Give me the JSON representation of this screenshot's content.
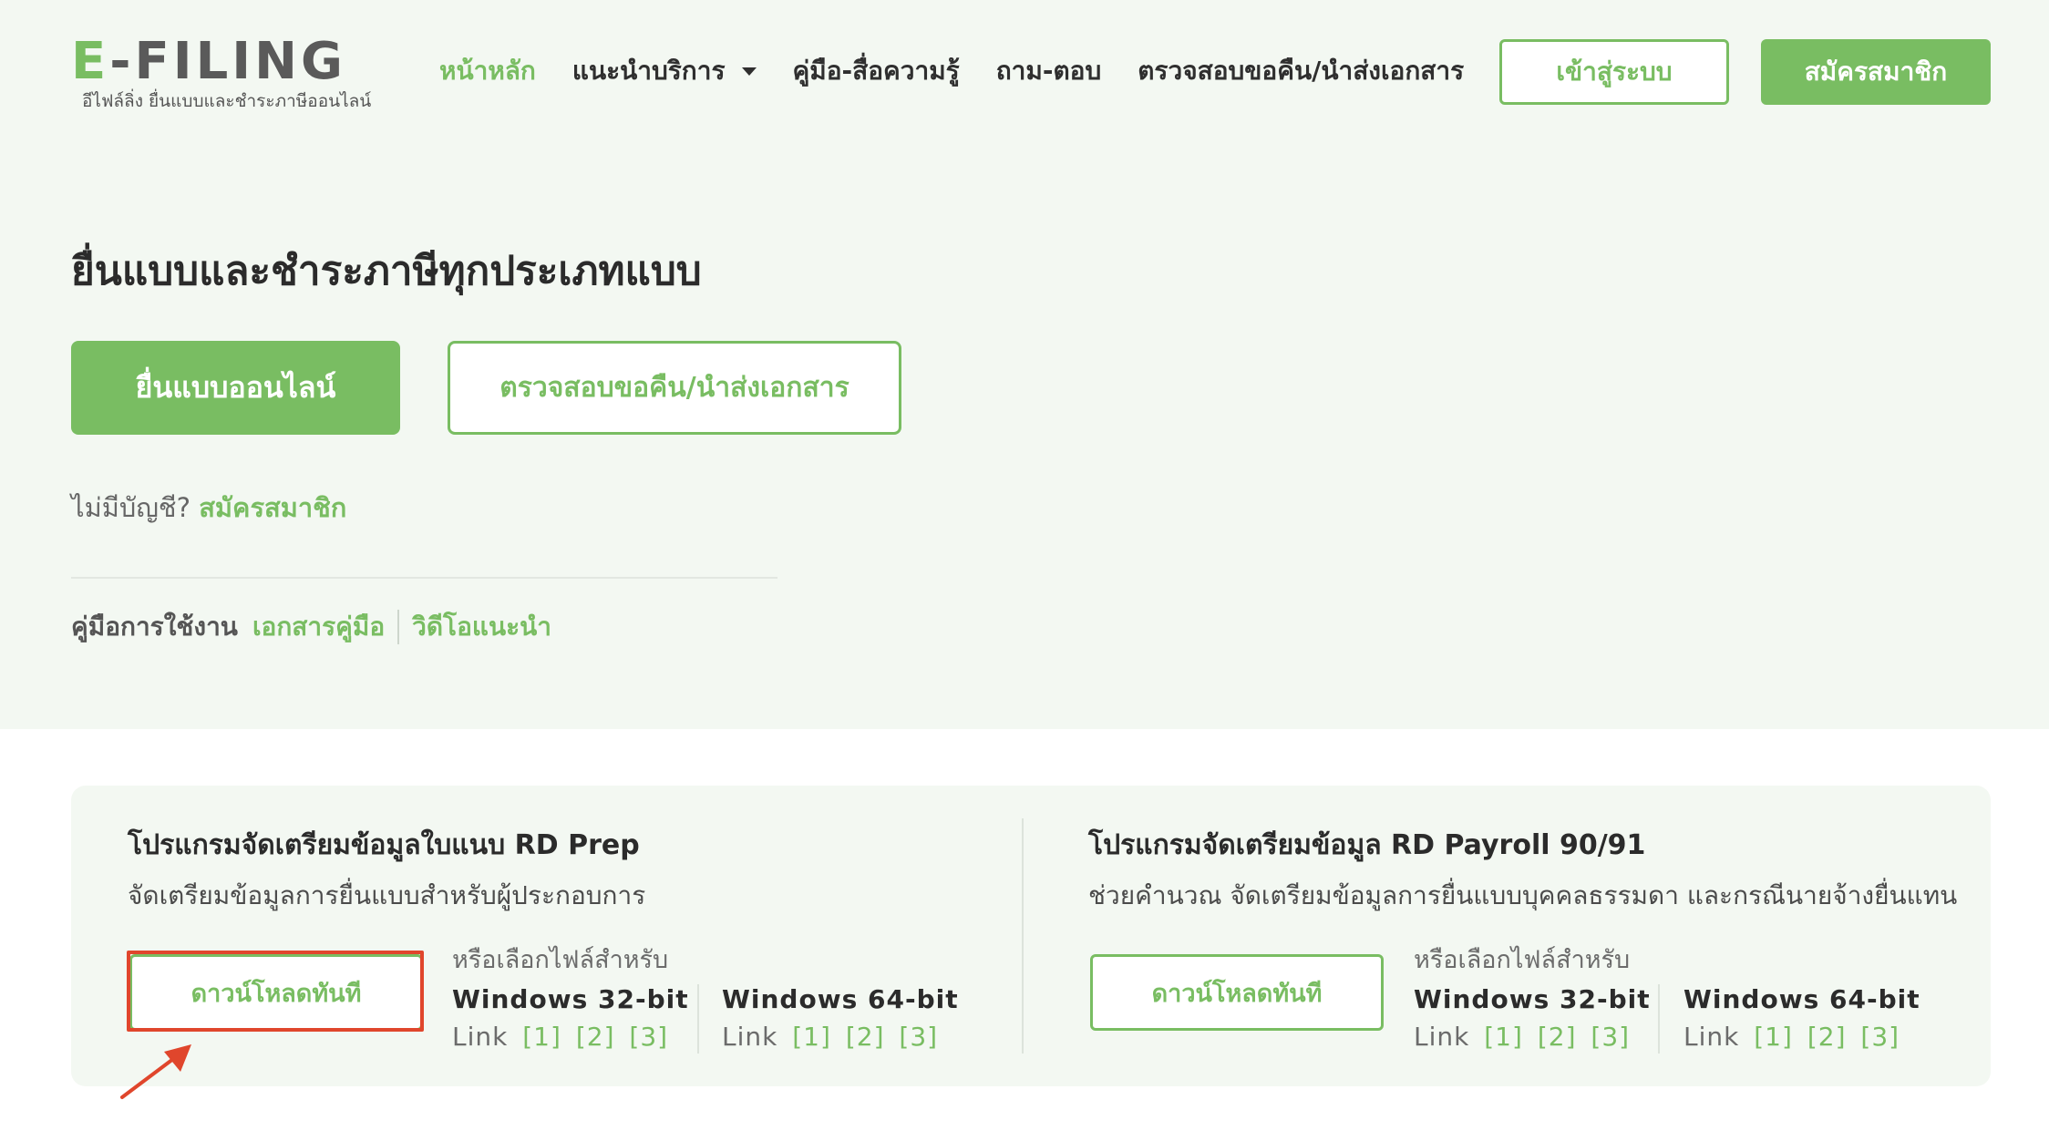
{
  "brand": {
    "logo_e": "E",
    "logo_rest": "-FILING",
    "tagline": "อีไฟล์ลิ่ง ยื่นแบบและชำระภาษีออนไลน์",
    "accent": "#79bd62",
    "highlight": "#e0462c"
  },
  "nav": {
    "home": "หน้าหลัก",
    "services": "แนะนำบริการ",
    "guide": "คู่มือ-สื่อความรู้",
    "faq": "ถาม-ตอบ",
    "refund": "ตรวจสอบขอคืน/นำส่งเอกสาร",
    "login": "เข้าสู่ระบบ",
    "register": "สมัครสมาชิก"
  },
  "hero": {
    "title": "ยื่นแบบและชำระภาษีทุกประเภทแบบ",
    "file_online": "ยื่นแบบออนไลน์",
    "check_refund": "ตรวจสอบขอคืน/นำส่งเอกสาร",
    "no_account": "ไม่มีบัญชี?",
    "register_link": "สมัครสมาชิก",
    "manual_label": "คู่มือการใช้งาน",
    "manual_docs": "เอกสารคู่มือ",
    "manual_video": "วิดีโอแนะนำ"
  },
  "downloads": [
    {
      "title": "โปรแกรมจัดเตรียมข้อมูลใบแนบ RD Prep",
      "subtitle": "จัดเตรียมข้อมูลการยื่นแบบสำหรับผู้ประกอบการ",
      "button": "ดาวน์โหลดทันที",
      "or_choose": "หรือเลือกไฟล์สำหรับ",
      "os": [
        {
          "name": "Windows 32-bit",
          "link_label": "Link",
          "links": [
            "[1]",
            "[2]",
            "[3]"
          ]
        },
        {
          "name": "Windows 64-bit",
          "link_label": "Link",
          "links": [
            "[1]",
            "[2]",
            "[3]"
          ]
        }
      ]
    },
    {
      "title": "โปรแกรมจัดเตรียมข้อมูล RD Payroll 90/91",
      "subtitle": "ช่วยคำนวณ จัดเตรียมข้อมูลการยื่นแบบบุคคลธรรมดา และกรณีนายจ้างยื่นแทน",
      "button": "ดาวน์โหลดทันที",
      "or_choose": "หรือเลือกไฟล์สำหรับ",
      "os": [
        {
          "name": "Windows 32-bit",
          "link_label": "Link",
          "links": [
            "[1]",
            "[2]",
            "[3]"
          ]
        },
        {
          "name": "Windows 64-bit",
          "link_label": "Link",
          "links": [
            "[1]",
            "[2]",
            "[3]"
          ]
        }
      ]
    }
  ]
}
